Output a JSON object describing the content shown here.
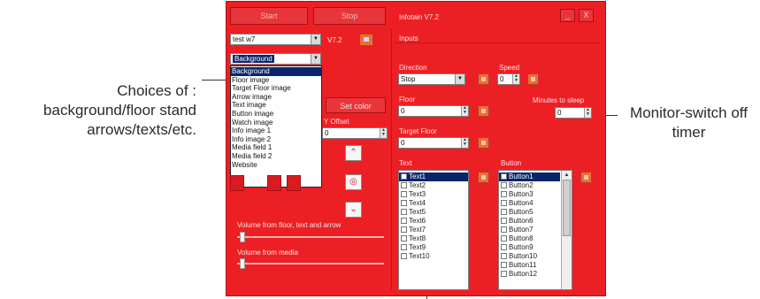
{
  "annotations": {
    "left_caption_lines": [
      "Choices of :",
      "background/floor stand",
      "arrows/texts/etc."
    ],
    "right_caption_lines": [
      "Monitor-switch off",
      "timer"
    ]
  },
  "window": {
    "title": "Infotain V7.2",
    "minimize_label": "_",
    "close_label": "X",
    "top_left_buttons": [
      "Start",
      "Stop"
    ]
  },
  "left_panel": {
    "config_dropdown_value": "test w7",
    "version_label": "V7.2",
    "image_dropdown_value": "Background",
    "image_options": [
      "Background",
      "Floor image",
      "Target Floor image",
      "Arrow image",
      "Text image",
      "Button image",
      "Watch image",
      "Info image 1",
      "Info image 2",
      "Media field 1",
      "Media field 2",
      "Website"
    ],
    "selected_option": "Background",
    "set_color_label": "Set color",
    "y_offset_label": "Y Offset",
    "y_offset_value": "0",
    "volume_floor_label": "Volume from floor, text and arrow",
    "volume_floor_level": 0.03,
    "volume_media_label": "Volume from media",
    "volume_media_level": 0.03
  },
  "inputs": {
    "section_label": "Inputs",
    "direction_label": "Direction",
    "direction_value": "Stop",
    "speed_label": "Speed",
    "speed_value": "0",
    "floor_label": "Floor",
    "floor_value": "0",
    "minutes_label": "Minutes to sleep",
    "minutes_value": "0",
    "target_floor_label": "Target Floor",
    "target_floor_value": "0",
    "text_label": "Text",
    "text_items": [
      "Text1",
      "Text2",
      "Text3",
      "Text4",
      "Text5",
      "Text6",
      "Text7",
      "Text8",
      "Text9",
      "Text10"
    ],
    "button_label": "Button",
    "button_items": [
      "Button1",
      "Button2",
      "Button3",
      "Button4",
      "Button5",
      "Button6",
      "Button7",
      "Button8",
      "Button9",
      "Button10",
      "Button11",
      "Button12"
    ]
  },
  "colors": {
    "window_red": "#ec1f24",
    "selection_blue": "#0a246a"
  }
}
